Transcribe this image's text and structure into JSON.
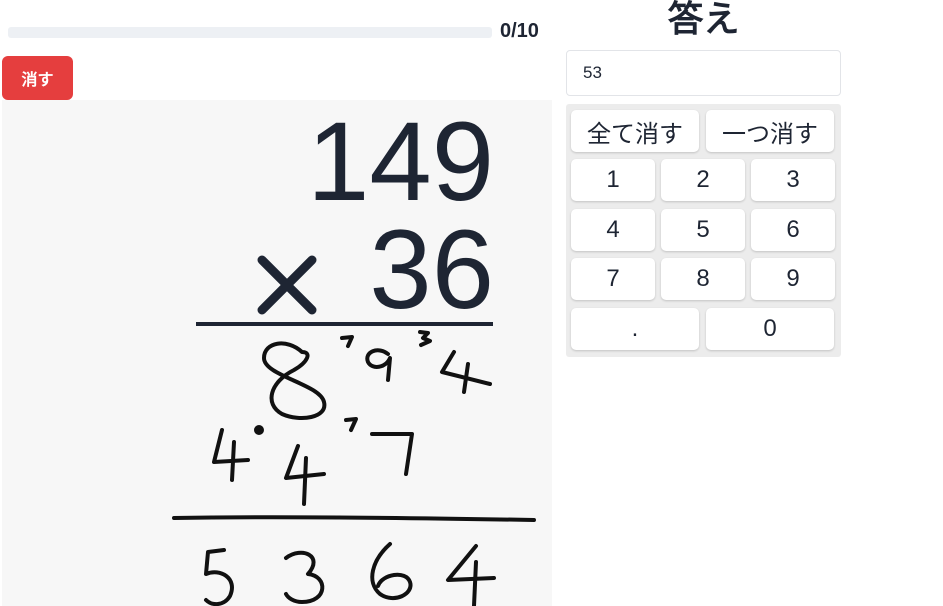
{
  "progress": {
    "current": 0,
    "total": 10,
    "text": "0/10"
  },
  "toolbar": {
    "clear_label": "消す"
  },
  "problem": {
    "multiplicand": "149",
    "multiplier": "36",
    "operator": "×"
  },
  "answer": {
    "title": "答え",
    "value": "53"
  },
  "keypad": {
    "clear_all": "全て消す",
    "backspace": "一つ消す",
    "keys": [
      "1",
      "2",
      "3",
      "4",
      "5",
      "6",
      "7",
      "8",
      "9",
      ".",
      "0"
    ]
  },
  "colors": {
    "clear_button": "#e53e3e",
    "text": "#1e2533",
    "canvas_bg": "#f7f7f7",
    "keypad_bg": "#ececec"
  }
}
